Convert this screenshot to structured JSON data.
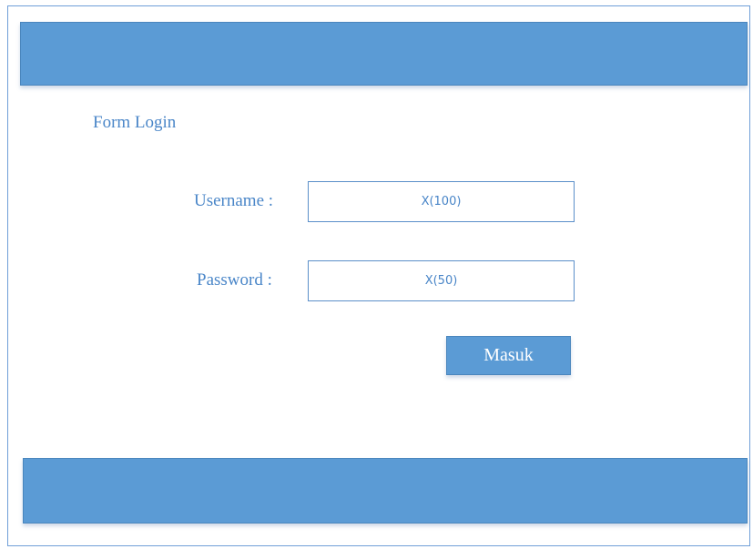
{
  "form": {
    "title": "Form Login",
    "username": {
      "label": "Username :",
      "value": "X(100)"
    },
    "password": {
      "label": "Password :",
      "value": "X(50)"
    },
    "submit_label": "Masuk"
  },
  "colors": {
    "accent": "#5b9bd5",
    "text": "#4a86c8",
    "border": "#5b8fc9"
  }
}
